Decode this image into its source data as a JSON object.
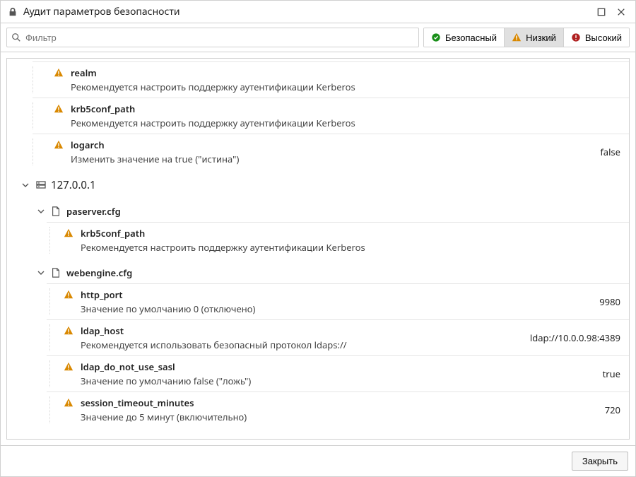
{
  "window": {
    "title": "Аудит параметров безопасности"
  },
  "toolbar": {
    "filter_placeholder": "Фильтр",
    "levels": {
      "safe": {
        "label": "Безопасный",
        "active": false
      },
      "low": {
        "label": "Низкий",
        "active": true
      },
      "high": {
        "label": "Высокий",
        "active": false
      }
    }
  },
  "tree": {
    "orphan_items": [
      {
        "name": "realm",
        "hint": "Рекомендуется настроить поддержку аутентификации Kerberos",
        "value": ""
      },
      {
        "name": "krb5conf_path",
        "hint": "Рекомендуется настроить поддержку аутентификации Kerberos",
        "value": ""
      },
      {
        "name": "logarch",
        "hint": "Изменить значение на true (\"истина\")",
        "value": "false"
      }
    ],
    "host": {
      "label": "127.0.0.1",
      "files": [
        {
          "name": "paserver.cfg",
          "items": [
            {
              "name": "krb5conf_path",
              "hint": "Рекомендуется настроить поддержку аутентификации Kerberos",
              "value": ""
            }
          ]
        },
        {
          "name": "webengine.cfg",
          "items": [
            {
              "name": "http_port",
              "hint": "Значение по умолчанию 0 (отключено)",
              "value": "9980"
            },
            {
              "name": "ldap_host",
              "hint": "Рекомендуется использовать безопасный протокол ldaps://",
              "value": "ldap://10.0.0.98:4389"
            },
            {
              "name": "ldap_do_not_use_sasl",
              "hint": "Значение по умолчанию false (\"ложь\")",
              "value": "true"
            },
            {
              "name": "session_timeout_minutes",
              "hint": "Значение до 5 минут (включительно)",
              "value": "720"
            }
          ]
        }
      ]
    }
  },
  "footer": {
    "close_label": "Закрыть"
  },
  "colors": {
    "warn": "#b06600",
    "safe": "#1a8f1a",
    "high": "#b02020"
  }
}
